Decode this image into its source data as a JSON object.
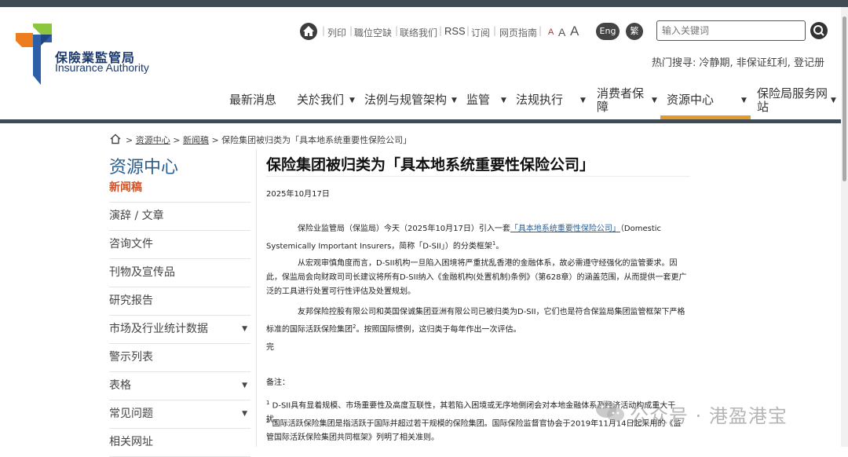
{
  "header": {
    "logo_cn": "保險業監管局",
    "logo_en": "Insurance Authority"
  },
  "utility": {
    "print": "列印",
    "vacancies": "職位空缺",
    "contact": "联络我们",
    "rss": "RSS",
    "subscribe": "订阅",
    "guide": "网页指南",
    "font_small": "A",
    "font_mid": "A",
    "font_large": "A",
    "lang_en": "Eng",
    "lang_tc": "繁"
  },
  "search": {
    "placeholder": "输入关键词",
    "hot_label": "热门搜寻:",
    "hot_items": "冷静期, 非保证红利, 登记册"
  },
  "nav": {
    "items": [
      "最新消息",
      "关於我们",
      "法例与规管架构",
      "监管",
      "法规执行",
      "消费者保障",
      "资源中心",
      "保险局服务网站"
    ],
    "active": "资源中心"
  },
  "breadcrumb": {
    "home": "首页",
    "level1": "资源中心",
    "level2": "新闻稿",
    "current": "保险集团被归类为「具本地系统重要性保险公司」"
  },
  "sidebar": {
    "title": "资源中心",
    "items": [
      {
        "label": "新闻稿",
        "active": true
      },
      {
        "label": "演辞 / 文章"
      },
      {
        "label": "咨询文件"
      },
      {
        "label": "刊物及宣传品"
      },
      {
        "label": "研究报告"
      },
      {
        "label": "市场及行业统计数据",
        "has_children": true
      },
      {
        "label": "警示列表"
      },
      {
        "label": "表格",
        "has_children": true
      },
      {
        "label": "常见问题",
        "has_children": true
      },
      {
        "label": "相关网址"
      }
    ]
  },
  "article": {
    "title": "保险集团被归类为「具本地系统重要性保险公司」",
    "date": "2025年10月17日",
    "p1_a": "保险业监管局（保监局）今天（2025年10月17日）引入一套",
    "p1_link": "「具本地系统重要性保险公司」",
    "p1_b": "（Domestic Systemically Important Insurers，简称「D-SII」）的分类框架",
    "p1_sup": "1",
    "p1_end": "。",
    "p2": "从宏观审慎角度而言，D-SII机构一旦陷入困境将严重扰乱香港的金融体系，故必需遵守经强化的监管要求。因此，保监局会向财政司司长建议将所有D-SII纳入《金融机构(处置机制)条例》（第628章）的涵盖范围，从而提供一套更广泛的工具进行处置可行性评估及处置规划。",
    "p3_a": "友邦保险控股有限公司和英国保诚集团亚洲有限公司已被归类为D-SII，它们也是符合保监局集团监管框架下严格标准的国际活跃保险集团",
    "p3_sup": "2",
    "p3_b": "。按照国际惯例，这归类于每年作出一次评估。",
    "end_mark": "完",
    "notes_label": "备注：",
    "note1_sup": "1",
    "note1": " D-SII具有显着规模、市场重要性及高度互联性，其若陷入困境或无序地倒闭会对本地金融体系及经济活动构成重大干扰。",
    "note2_sup": "2",
    "note2": " 国际活跃保险集团是指活跃于国际并超过若干规模的保险集团。国际保险监督官协会于2019年11月14日起采用的《监管国际活跃保险集团共同框架》列明了相关准则。"
  },
  "watermark": {
    "text": "公众号 · 港盈港宝"
  }
}
